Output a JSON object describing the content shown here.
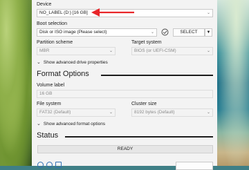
{
  "drive_properties": {
    "device_label": "Device",
    "device_value": "NO_LABEL (D:) [16 GB]",
    "boot_selection_label": "Boot selection",
    "boot_selection_value": "Disk or ISO image (Please select)",
    "select_button": "SELECT",
    "partition_scheme_label": "Partition scheme",
    "partition_scheme_value": "MBR",
    "target_system_label": "Target system",
    "target_system_value": "BIOS (or UEFI-CSM)",
    "advanced_drive": "Show advanced drive properties"
  },
  "format_options": {
    "title": "Format Options",
    "volume_label_label": "Volume label",
    "volume_label_value": "16 GB",
    "file_system_label": "File system",
    "file_system_value": "FAT32 (Default)",
    "cluster_size_label": "Cluster size",
    "cluster_size_value": "8192 bytes (Default)",
    "advanced_format": "Show advanced format options"
  },
  "status": {
    "title": "Status",
    "state": "READY"
  },
  "colors": {
    "arrow": "#e8262a",
    "window": "#f3f3f3",
    "icon_blue": "#2f6fb3"
  }
}
